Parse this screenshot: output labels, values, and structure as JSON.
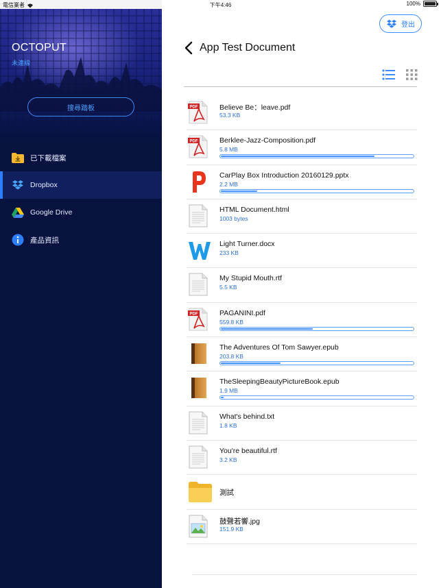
{
  "status_bar": {
    "carrier": "電信業者",
    "time": "下午4:46",
    "battery": "100%"
  },
  "sidebar": {
    "app_title": "OCTOPUT",
    "connection_status": "未連線",
    "search_pad_label": "搜尋踏板",
    "items": [
      {
        "label": "已下載檔案",
        "icon": "download-folder-icon",
        "active": false
      },
      {
        "label": "Dropbox",
        "icon": "dropbox-icon",
        "active": true
      },
      {
        "label": "Google Drive",
        "icon": "google-drive-icon",
        "active": false
      },
      {
        "label": "產品資訊",
        "icon": "info-icon",
        "active": false
      }
    ]
  },
  "header": {
    "logout_label": "登出",
    "title": "App Test Document"
  },
  "colors": {
    "accent": "#2c7dff",
    "sidebar_bg": "#07123f",
    "size_text": "#2b6fd6"
  },
  "files": [
    {
      "name": "Believe Be：leave.pdf",
      "size": "53.3 KB",
      "type": "pdf",
      "progress": null
    },
    {
      "name": "Berklee-Jazz-Composition.pdf",
      "size": "5.8 MB",
      "type": "pdf",
      "progress": 0.8
    },
    {
      "name": "CarPlay Box Introduction 20160129.pptx",
      "size": "2.2 MB",
      "type": "pptx",
      "progress": 0.19
    },
    {
      "name": "HTML Document.html",
      "size": "1003 bytes",
      "type": "text",
      "progress": null
    },
    {
      "name": "Light Turner.docx",
      "size": "233 KB",
      "type": "docx",
      "progress": null
    },
    {
      "name": "My Stupid Mouth.rtf",
      "size": "5.5 KB",
      "type": "text",
      "progress": null
    },
    {
      "name": "PAGANINI.pdf",
      "size": "559.8 KB",
      "type": "pdf",
      "progress": 0.48
    },
    {
      "name": "The Adventures Of Tom Sawyer.epub",
      "size": "203.8 KB",
      "type": "epub",
      "progress": 0.31
    },
    {
      "name": "TheSleepingBeautyPictureBook.epub",
      "size": "1.9 MB",
      "type": "epub",
      "progress": 0.01
    },
    {
      "name": "What's behind.txt",
      "size": "1.8 KB",
      "type": "text",
      "progress": null
    },
    {
      "name": "You're beautiful.rtf",
      "size": "3.2 KB",
      "type": "text",
      "progress": null
    },
    {
      "name": "測試",
      "size": "",
      "type": "folder",
      "progress": null
    },
    {
      "name": "鼓聲若響.jpg",
      "size": "151.9 KB",
      "type": "image",
      "progress": null
    }
  ]
}
